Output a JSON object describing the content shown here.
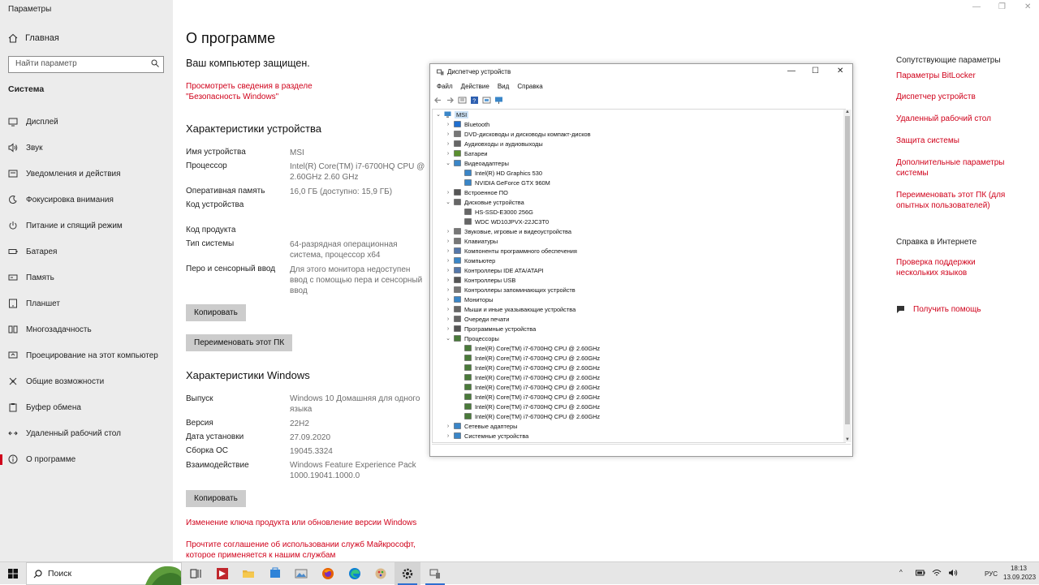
{
  "window": {
    "app_title": "Параметры",
    "controls": [
      "—",
      "❐",
      "✕"
    ]
  },
  "sidebar": {
    "home_label": "Главная",
    "search_placeholder": "Найти параметр",
    "section": "Система",
    "items": [
      {
        "label": "Дисплей",
        "icon": "display-icon"
      },
      {
        "label": "Звук",
        "icon": "sound-icon"
      },
      {
        "label": "Уведомления и действия",
        "icon": "notifications-icon"
      },
      {
        "label": "Фокусировка внимания",
        "icon": "focus-icon"
      },
      {
        "label": "Питание и спящий режим",
        "icon": "power-icon"
      },
      {
        "label": "Батарея",
        "icon": "battery-icon"
      },
      {
        "label": "Память",
        "icon": "storage-icon"
      },
      {
        "label": "Планшет",
        "icon": "tablet-icon"
      },
      {
        "label": "Многозадачность",
        "icon": "multitasking-icon"
      },
      {
        "label": "Проецирование на этот компьютер",
        "icon": "projecting-icon"
      },
      {
        "label": "Общие возможности",
        "icon": "shared-icon"
      },
      {
        "label": "Буфер обмена",
        "icon": "clipboard-icon"
      },
      {
        "label": "Удаленный рабочий стол",
        "icon": "remote-desktop-icon"
      },
      {
        "label": "О программе",
        "icon": "info-icon",
        "active": true
      }
    ]
  },
  "main": {
    "title": "О программе",
    "protected": "Ваш компьютер защищен.",
    "security_link_1": "Просмотреть сведения в разделе",
    "security_link_2": "\"Безопасность Windows\"",
    "device_specs_title": "Характеристики устройства",
    "device_specs": [
      {
        "label": "Имя устройства",
        "value": "MSI"
      },
      {
        "label": "Процессор",
        "value": "Intel(R) Core(TM) i7-6700HQ CPU @ 2.60GHz   2.60 GHz"
      },
      {
        "label": "Оперативная память",
        "value": "16,0 ГБ (доступно: 15,9 ГБ)"
      },
      {
        "label": "Код устройства",
        "value": ""
      },
      {
        "label": "Код продукта",
        "value": ""
      },
      {
        "label": "Тип системы",
        "value": "64-разрядная операционная система, процессор x64"
      },
      {
        "label": "Перо и сенсорный ввод",
        "value": "Для этого монитора недоступен ввод с помощью пера и сенсорный ввод"
      }
    ],
    "copy_button": "Копировать",
    "rename_button": "Переименовать этот ПК",
    "windows_specs_title": "Характеристики Windows",
    "windows_specs": [
      {
        "label": "Выпуск",
        "value": "Windows 10 Домашняя для одного языка"
      },
      {
        "label": "Версия",
        "value": "22H2"
      },
      {
        "label": "Дата установки",
        "value": "27.09.2020"
      },
      {
        "label": "Сборка ОС",
        "value": "19045.3324"
      },
      {
        "label": "Взаимодействие",
        "value": "Windows Feature Experience Pack 1000.19041.1000.0"
      }
    ],
    "copy_button_2": "Копировать",
    "link_product_key": "Изменение ключа продукта или обновление версии Windows",
    "link_agreement_1": "Прочтите соглашение об использовании служб Майкрософт,",
    "link_agreement_2": "которое применяется к нашим службам"
  },
  "right": {
    "related_title": "Сопутствующие параметры",
    "related_links": [
      "Параметры BitLocker",
      "Диспетчер устройств",
      "Удаленный рабочий стол",
      "Защита системы",
      "Дополнительные параметры системы",
      "Переименовать этот ПК (для опытных пользователей)"
    ],
    "help_title": "Справка в Интернете",
    "help_link": "Проверка поддержки нескольких языков",
    "get_help": "Получить помощь"
  },
  "device_manager": {
    "title": "Диспетчер устройств",
    "menu": [
      "Файл",
      "Действие",
      "Вид",
      "Справка"
    ],
    "root": "MSI",
    "tree": [
      {
        "label": "Bluetooth",
        "level": 1,
        "state": "collapsed",
        "color": "#1f6fd0"
      },
      {
        "label": "DVD-дисководы и дисководы компакт-дисков",
        "level": 1,
        "state": "collapsed",
        "color": "#777777"
      },
      {
        "label": "Аудиовходы и аудиовыходы",
        "level": 1,
        "state": "collapsed",
        "color": "#666666"
      },
      {
        "label": "Батареи",
        "level": 1,
        "state": "collapsed",
        "color": "#5a8f2e"
      },
      {
        "label": "Видеоадаптеры",
        "level": 1,
        "state": "expanded",
        "color": "#3a86c8"
      },
      {
        "label": "Intel(R) HD Graphics 530",
        "level": 2,
        "color": "#3a86c8"
      },
      {
        "label": "NVIDIA GeForce GTX 960M",
        "level": 2,
        "color": "#3a86c8"
      },
      {
        "label": "Встроенное ПО",
        "level": 1,
        "state": "collapsed",
        "color": "#555555"
      },
      {
        "label": "Дисковые устройства",
        "level": 1,
        "state": "expanded",
        "color": "#666666"
      },
      {
        "label": "HS-SSD-E3000 256G",
        "level": 2,
        "color": "#666666"
      },
      {
        "label": "WDC WD10JPVX-22JC3T0",
        "level": 2,
        "color": "#666666"
      },
      {
        "label": "Звуковые, игровые и видеоустройства",
        "level": 1,
        "state": "collapsed",
        "color": "#777777"
      },
      {
        "label": "Клавиатуры",
        "level": 1,
        "state": "collapsed",
        "color": "#777777"
      },
      {
        "label": "Компоненты программного обеспечения",
        "level": 1,
        "state": "collapsed",
        "color": "#5577aa"
      },
      {
        "label": "Компьютер",
        "level": 1,
        "state": "collapsed",
        "color": "#3a86c8"
      },
      {
        "label": "Контроллеры IDE ATA/ATAPI",
        "level": 1,
        "state": "collapsed",
        "color": "#5577aa"
      },
      {
        "label": "Контроллеры USB",
        "level": 1,
        "state": "collapsed",
        "color": "#555555"
      },
      {
        "label": "Контроллеры запоминающих устройств",
        "level": 1,
        "state": "collapsed",
        "color": "#777777"
      },
      {
        "label": "Мониторы",
        "level": 1,
        "state": "collapsed",
        "color": "#3a86c8"
      },
      {
        "label": "Мыши и иные указывающие устройства",
        "level": 1,
        "state": "collapsed",
        "color": "#666666"
      },
      {
        "label": "Очереди печати",
        "level": 1,
        "state": "collapsed",
        "color": "#666666"
      },
      {
        "label": "Программные устройства",
        "level": 1,
        "state": "collapsed",
        "color": "#555555"
      },
      {
        "label": "Процессоры",
        "level": 1,
        "state": "expanded",
        "color": "#4a7a3a"
      },
      {
        "label": "Intel(R) Core(TM) i7-6700HQ CPU @ 2.60GHz",
        "level": 2,
        "color": "#4a7a3a"
      },
      {
        "label": "Intel(R) Core(TM) i7-6700HQ CPU @ 2.60GHz",
        "level": 2,
        "color": "#4a7a3a"
      },
      {
        "label": "Intel(R) Core(TM) i7-6700HQ CPU @ 2.60GHz",
        "level": 2,
        "color": "#4a7a3a"
      },
      {
        "label": "Intel(R) Core(TM) i7-6700HQ CPU @ 2.60GHz",
        "level": 2,
        "color": "#4a7a3a"
      },
      {
        "label": "Intel(R) Core(TM) i7-6700HQ CPU @ 2.60GHz",
        "level": 2,
        "color": "#4a7a3a"
      },
      {
        "label": "Intel(R) Core(TM) i7-6700HQ CPU @ 2.60GHz",
        "level": 2,
        "color": "#4a7a3a"
      },
      {
        "label": "Intel(R) Core(TM) i7-6700HQ CPU @ 2.60GHz",
        "level": 2,
        "color": "#4a7a3a"
      },
      {
        "label": "Intel(R) Core(TM) i7-6700HQ CPU @ 2.60GHz",
        "level": 2,
        "color": "#4a7a3a"
      },
      {
        "label": "Сетевые адаптеры",
        "level": 1,
        "state": "collapsed",
        "color": "#3a86c8"
      },
      {
        "label": "Системные устройства",
        "level": 1,
        "state": "collapsed",
        "color": "#3a86c8"
      }
    ]
  },
  "taskbar": {
    "search_label": "Поиск",
    "language": "РУС",
    "time": "18:13",
    "date": "13.09.2023"
  },
  "colors": {
    "accent": "#d0021b",
    "sidebar_bg": "#ececec",
    "taskbar_bg": "#e6e6e6"
  }
}
